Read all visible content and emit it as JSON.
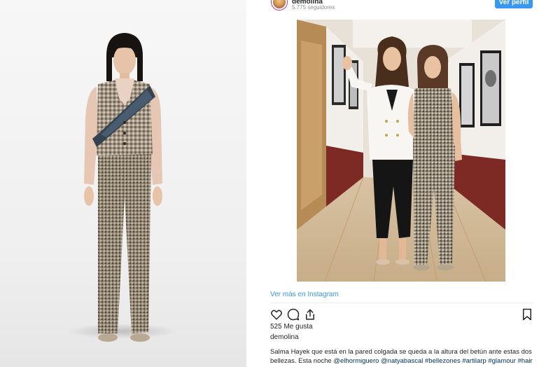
{
  "profile": {
    "username": "demolina",
    "followers": "5.775 seguidores",
    "view_profile_label": "Ver perfil"
  },
  "post": {
    "view_more_label": "Ver más en Instagram",
    "likes": "525 Me gusta",
    "author": "demolina",
    "caption_text": "Salma Hayek que está en la pared colgada se queda a la altura del betún ante estas dos bellezas. Esta noche",
    "caption_tags": "@elhormiguero @natyabascal #bellezones #artilarp #glamour #hair"
  },
  "icons": {
    "like": "heart-icon",
    "comment": "comment-icon",
    "share": "share-icon",
    "save": "bookmark-icon"
  },
  "colors": {
    "accent": "#3897f0",
    "text": "#262626",
    "muted": "#8e8e8e",
    "hashtag": "#003569"
  }
}
